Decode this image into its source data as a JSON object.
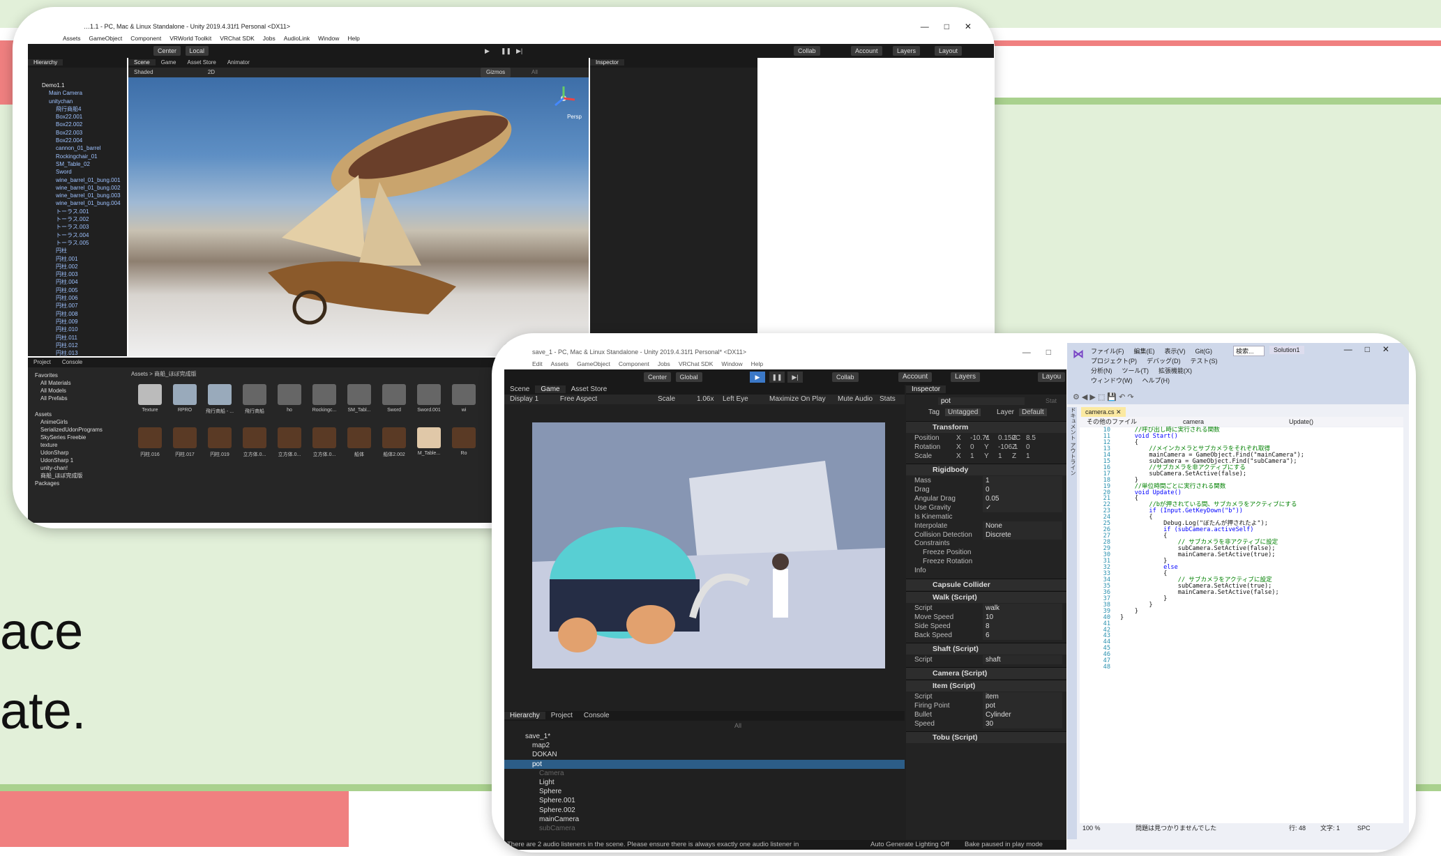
{
  "colors": {
    "accent_red": "#f08080",
    "accent_green": "#a9d18e",
    "soft_green": "#e2f0d9",
    "unity_dark": "#202020",
    "vs_blue": "#cfd8ea"
  },
  "slide_text": {
    "line1": "ace",
    "line2": "ate."
  },
  "window1": {
    "title": "…1.1 - PC, Mac & Linux Standalone - Unity 2019.4.31f1 Personal <DX11>",
    "menu": [
      "Assets",
      "GameObject",
      "Component",
      "VRWorld Toolkit",
      "VRChat SDK",
      "Jobs",
      "AudioLink",
      "Window",
      "Help"
    ],
    "toolbar": {
      "center": "Center",
      "local": "Local",
      "collab": "Collab",
      "account": "Account",
      "layers": "Layers",
      "layout": "Layout"
    },
    "hierarchy_tab": "Hierarchy",
    "scene_tabs": [
      "Scene",
      "Game",
      "Asset Store",
      "Animator"
    ],
    "scene_bar": {
      "shading": "Shaded",
      "mode2d": "2D",
      "gizmos": "Gizmos",
      "search": "All"
    },
    "inspector_tab": "Inspector",
    "persp": "Persp",
    "hierarchy_items": [
      "Demo1.1",
      "Main Camera",
      "unitychan",
      "飛行商船4",
      "Box22.001",
      "Box22.002",
      "Box22.003",
      "Box22.004",
      "cannon_01_barrel",
      "Rockingchair_01",
      "SM_Table_02",
      "Sword",
      "wine_barrel_01_bung.001",
      "wine_barrel_01_bung.002",
      "wine_barrel_01_bung.003",
      "wine_barrel_01_bung.004",
      "トーラス.001",
      "トーラス.002",
      "トーラス.003",
      "トーラス.004",
      "トーラス.005",
      "円柱",
      "円柱.001",
      "円柱.002",
      "円柱.003",
      "円柱.004",
      "円柱.005",
      "円柱.006",
      "円柱.007",
      "円柱.008",
      "円柱.009",
      "円柱.010",
      "円柱.011",
      "円柱.012",
      "円柱.013"
    ],
    "bottom_tabs": [
      "Project",
      "Console"
    ],
    "favorites": [
      "Favorites",
      "All Materials",
      "All Models",
      "All Prefabs"
    ],
    "assets_tree": [
      "Assets",
      "AnimeGirls",
      "SerializedUdonPrograms",
      "SkySeries Freebie",
      "texture",
      "UdonSharp",
      "UdonSharp 1",
      "unity-chan!",
      "商船_ほぼ完成版",
      "Packages"
    ],
    "breadcrumb": "Assets > 商船_ほぼ完成版",
    "assets_row1": [
      "Texture",
      "RPRO",
      "飛行商船 - ...",
      "飛行商船",
      "ho",
      "Rockingc...",
      "SM_Tabl...",
      "Sword",
      "Sword.001",
      "wi"
    ],
    "assets_row2": [
      "円柱.016",
      "円柱.017",
      "円柱.019",
      "立方体.0...",
      "立方体.0...",
      "立方体.0...",
      "船体",
      "船体2.002",
      "M_Table...",
      "Ro"
    ]
  },
  "window2": {
    "title": "save_1 - PC, Mac & Linux Standalone - Unity 2019.4.31f1 Personal* <DX11>",
    "menu": [
      "Edit",
      "Assets",
      "GameObject",
      "Component",
      "Jobs",
      "VRChat SDK",
      "Window",
      "Help"
    ],
    "toolbar": {
      "center": "Center",
      "global": "Global",
      "collab": "Collab",
      "account": "Account",
      "layers": "Layers",
      "layout": "Layou"
    },
    "game_tabs": [
      "Scene",
      "Game",
      "Asset Store"
    ],
    "game_bar": {
      "display": "Display 1",
      "aspect": "Free Aspect",
      "scale_label": "Scale",
      "scale_value": "1.06x",
      "eye": "Left Eye",
      "maximize": "Maximize On Play",
      "mute": "Mute Audio",
      "stats": "Stats",
      "gizmos": "Gizm"
    },
    "hier_tabs": [
      "Hierarchy",
      "Project",
      "Console"
    ],
    "hier_search": "All",
    "hierarchy": [
      "save_1*",
      "map2",
      "DOKAN",
      "pot",
      "Camera",
      "Light",
      "Sphere",
      "Sphere.001",
      "Sphere.002",
      "mainCamera",
      "subCamera"
    ],
    "status": "There are 2 audio listeners in the scene. Please ensure there is always exactly one audio listener in",
    "status_right": "Auto Generate Lighting Off",
    "status_bake": "Bake paused in play mode",
    "inspector": {
      "tab": "Inspector",
      "name": "pot",
      "static": "Stat",
      "tag_label": "Tag",
      "tag": "Untagged",
      "layer_label": "Layer",
      "layer": "Default",
      "transform": "Transform",
      "position": [
        "Position",
        "X",
        "-10.71",
        "Y",
        "0.150C",
        "Z",
        "8.5"
      ],
      "rotation": [
        "Rotation",
        "X",
        "0",
        "Y",
        "-106.1",
        "Z",
        "0"
      ],
      "scale": [
        "Scale",
        "X",
        "1",
        "Y",
        "1",
        "Z",
        "1"
      ],
      "rigidbody": "Rigidbody",
      "rb": [
        [
          "Mass",
          "1"
        ],
        [
          "Drag",
          "0"
        ],
        [
          "Angular Drag",
          "0.05"
        ],
        [
          "Use Gravity",
          "✓"
        ],
        [
          "Is Kinematic",
          ""
        ],
        [
          "Interpolate",
          "None"
        ],
        [
          "Collision Detection",
          "Discrete"
        ]
      ],
      "constraints": "Constraints",
      "freeze_pos": "Freeze Position",
      "freeze_rot": "Freeze Rotation",
      "info": "Info",
      "capsule": "Capsule Collider",
      "walk": "Walk (Script)",
      "walk_rows": [
        [
          "Script",
          "walk"
        ],
        [
          "Move Speed",
          "10"
        ],
        [
          "Side Speed",
          "8"
        ],
        [
          "Back Speed",
          "6"
        ]
      ],
      "shaft": "Shaft (Script)",
      "shaft_script": [
        "Script",
        "shaft"
      ],
      "camera_script": "Camera (Script)",
      "item": "Item (Script)",
      "item_rows": [
        [
          "Script",
          "item"
        ],
        [
          "Firing Point",
          "pot"
        ],
        [
          "Bullet",
          "Cylinder"
        ],
        [
          "Speed",
          "30"
        ]
      ],
      "tobu": "Tobu (Script)"
    }
  },
  "vs": {
    "menu_row1": [
      "ファイル(F)",
      "編集(E)",
      "表示(V)",
      "Git(G)"
    ],
    "menu_row2": [
      "プロジェクト(P)",
      "デバッグ(D)",
      "テスト(S)"
    ],
    "menu_row3": [
      "分析(N)",
      "ツール(T)",
      "拡張機能(X)"
    ],
    "menu_row4": [
      "ウィンドウ(W)",
      "ヘルプ(H)"
    ],
    "search": "検索...",
    "solution": "Solution1",
    "side_tab": "ドキュメント アウトライン",
    "file_tab": "camera.cs",
    "nav": [
      "その他のファイル",
      "camera",
      "Update()"
    ],
    "line_start": 10,
    "code": [
      "",
      "",
      "    //呼び出し時に実行される関数",
      "    void Start()",
      "    {",
      "        //メインカメラとサブカメラをそれぞれ取得",
      "        mainCamera = GameObject.Find(\"mainCamera\");",
      "        subCamera = GameObject.Find(\"subCamera\");",
      "",
      "",
      "        //サブカメラを非アクティブにする",
      "        subCamera.SetActive(false);",
      "    }",
      "",
      "",
      "    //単位時間ごとに実行される関数",
      "    void Update()",
      "    {",
      "        //bが押されている間、サブカメラをアクティブにする",
      "        if (Input.GetKeyDown(\"b\"))",
      "        {",
      "            Debug.Log(\"ぼたんが押されたよ\");",
      "",
      "            if (subCamera.activeSelf)",
      "            {",
      "                // サブカメラを非アクティブに設定",
      "                subCamera.SetActive(false);",
      "                mainCamera.SetActive(true);",
      "            }",
      "            else",
      "            {",
      "                // サブカメラをアクティブに設定",
      "                subCamera.SetActive(true);",
      "                mainCamera.SetActive(false);",
      "            }",
      "        }",
      "    }",
      "}",
      ""
    ],
    "status": {
      "zoom": "100 %",
      "issues": "問題は見つかりませんでした",
      "line": "行: 48",
      "col": "文字: 1",
      "mode": "SPC"
    }
  }
}
